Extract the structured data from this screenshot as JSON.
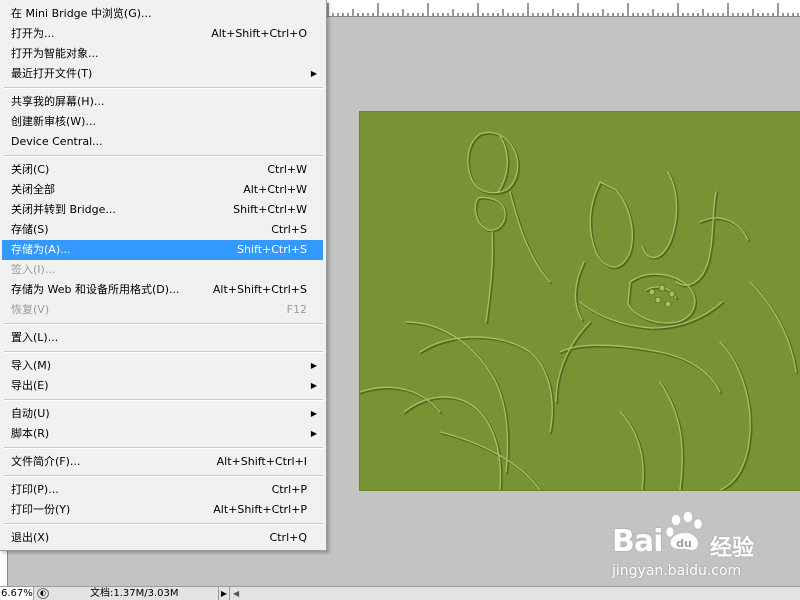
{
  "menu": {
    "items": [
      {
        "label": "在 Mini Bridge 中浏览(G)...",
        "shortcut": "",
        "submenu": false,
        "disabled": false
      },
      {
        "label": "打开为...",
        "shortcut": "Alt+Shift+Ctrl+O",
        "submenu": false,
        "disabled": false
      },
      {
        "label": "打开为智能对象...",
        "shortcut": "",
        "submenu": false,
        "disabled": false
      },
      {
        "label": "最近打开文件(T)",
        "shortcut": "",
        "submenu": true,
        "disabled": false
      },
      {
        "label": "共享我的屏幕(H)...",
        "shortcut": "",
        "submenu": false,
        "disabled": false
      },
      {
        "label": "创建新审核(W)...",
        "shortcut": "",
        "submenu": false,
        "disabled": false
      },
      {
        "label": "Device Central...",
        "shortcut": "",
        "submenu": false,
        "disabled": false
      },
      {
        "label": "关闭(C)",
        "shortcut": "Ctrl+W",
        "submenu": false,
        "disabled": false
      },
      {
        "label": "关闭全部",
        "shortcut": "Alt+Ctrl+W",
        "submenu": false,
        "disabled": false
      },
      {
        "label": "关闭并转到 Bridge...",
        "shortcut": "Shift+Ctrl+W",
        "submenu": false,
        "disabled": false
      },
      {
        "label": "存储(S)",
        "shortcut": "Ctrl+S",
        "submenu": false,
        "disabled": false
      },
      {
        "label": "存储为(A)...",
        "shortcut": "Shift+Ctrl+S",
        "submenu": false,
        "disabled": false,
        "selected": true
      },
      {
        "label": "签入(I)...",
        "shortcut": "",
        "submenu": false,
        "disabled": true
      },
      {
        "label": "存储为 Web 和设备所用格式(D)...",
        "shortcut": "Alt+Shift+Ctrl+S",
        "submenu": false,
        "disabled": false
      },
      {
        "label": "恢复(V)",
        "shortcut": "F12",
        "submenu": false,
        "disabled": true
      },
      {
        "label": "置入(L)...",
        "shortcut": "",
        "submenu": false,
        "disabled": false
      },
      {
        "label": "导入(M)",
        "shortcut": "",
        "submenu": true,
        "disabled": false
      },
      {
        "label": "导出(E)",
        "shortcut": "",
        "submenu": true,
        "disabled": false
      },
      {
        "label": "自动(U)",
        "shortcut": "",
        "submenu": true,
        "disabled": false
      },
      {
        "label": "脚本(R)",
        "shortcut": "",
        "submenu": true,
        "disabled": false
      },
      {
        "label": "文件简介(F)...",
        "shortcut": "Alt+Shift+Ctrl+I",
        "submenu": false,
        "disabled": false
      },
      {
        "label": "打印(P)...",
        "shortcut": "Ctrl+P",
        "submenu": false,
        "disabled": false
      },
      {
        "label": "打印一份(Y)",
        "shortcut": "Alt+Shift+Ctrl+P",
        "submenu": false,
        "disabled": false
      },
      {
        "label": "退出(X)",
        "shortcut": "Ctrl+Q",
        "submenu": false,
        "disabled": false
      }
    ],
    "highlight_color": "#3399ff"
  },
  "status": {
    "zoom": "6.67%",
    "doc_info": "文档:1.37M/3.03M",
    "play_icon": "triangle-right-icon"
  },
  "canvas": {
    "fill_color": "#789333",
    "content": "embossed-lotus-artwork"
  },
  "watermark": {
    "logo_text": "Bai",
    "logo_paw": "du",
    "cn_text": "经验",
    "url": "jingyan.baidu.com"
  }
}
